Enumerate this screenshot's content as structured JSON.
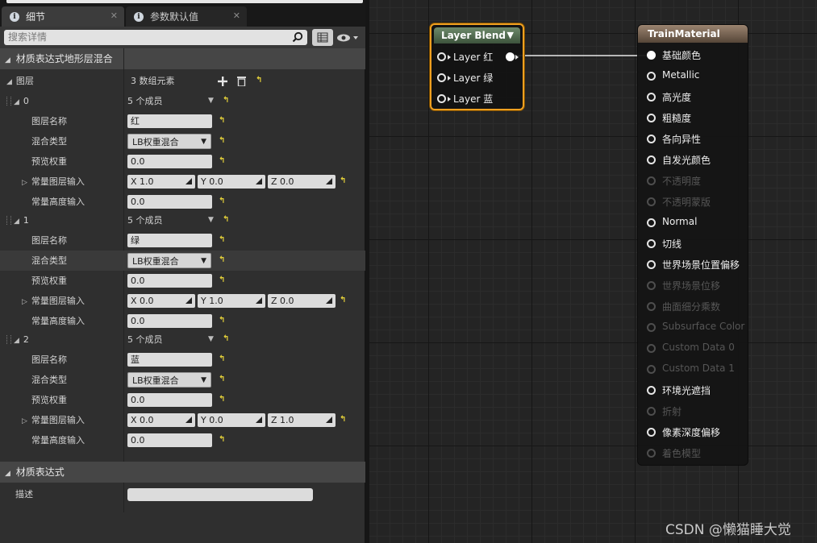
{
  "details_panel": {
    "tabs": [
      {
        "label": "细节",
        "icon": "info-icon"
      },
      {
        "label": "参数默认值",
        "icon": "info-icon"
      }
    ],
    "search_placeholder": "搜索详情",
    "category_main": "材质表达式地形层混合",
    "layers_label": "图层",
    "layers_count": "3 数组元素",
    "layers": [
      {
        "index": "0",
        "members": "5 个成员",
        "layer_name_label": "图层名称",
        "layer_name": "红",
        "blend_type_label": "混合类型",
        "blend_type": "LB权重混合",
        "preview_weight_label": "预览权重",
        "preview_weight": "0.0",
        "const_input_label": "常量图层输入",
        "x": "X  1.0",
        "y": "Y  0.0",
        "z": "Z  0.0",
        "const_height_label": "常量高度输入",
        "const_height": "0.0"
      },
      {
        "index": "1",
        "members": "5 个成员",
        "layer_name_label": "图层名称",
        "layer_name": "绿",
        "blend_type_label": "混合类型",
        "blend_type": "LB权重混合",
        "preview_weight_label": "预览权重",
        "preview_weight": "0.0",
        "const_input_label": "常量图层输入",
        "x": "X  0.0",
        "y": "Y  1.0",
        "z": "Z  0.0",
        "const_height_label": "常量高度输入",
        "const_height": "0.0"
      },
      {
        "index": "2",
        "members": "5 个成员",
        "layer_name_label": "图层名称",
        "layer_name": "蓝",
        "blend_type_label": "混合类型",
        "blend_type": "LB权重混合",
        "preview_weight_label": "预览权重",
        "preview_weight": "0.0",
        "const_input_label": "常量图层输入",
        "x": "X  0.0",
        "y": "Y  0.0",
        "z": "Z  1.0",
        "const_height_label": "常量高度输入",
        "const_height": "0.0"
      }
    ],
    "category_expression": "材质表达式",
    "desc_label": "描述",
    "desc_value": ""
  },
  "graph": {
    "layer_blend_node": {
      "title": "Layer Blend",
      "inputs": [
        "Layer 红",
        "Layer 绿",
        "Layer 蓝"
      ]
    },
    "material_node": {
      "title": "TrainMaterial",
      "pins": [
        {
          "label": "基础颜色",
          "enabled": true,
          "connected": true
        },
        {
          "label": "Metallic",
          "enabled": true
        },
        {
          "label": "高光度",
          "enabled": true
        },
        {
          "label": "粗糙度",
          "enabled": true
        },
        {
          "label": "各向异性",
          "enabled": true
        },
        {
          "label": "自发光颜色",
          "enabled": true
        },
        {
          "label": "不透明度",
          "enabled": false
        },
        {
          "label": "不透明蒙版",
          "enabled": false
        },
        {
          "label": "Normal",
          "enabled": true
        },
        {
          "label": "切线",
          "enabled": true
        },
        {
          "label": "世界场景位置偏移",
          "enabled": true
        },
        {
          "label": "世界场景位移",
          "enabled": false
        },
        {
          "label": "曲面细分乘数",
          "enabled": false
        },
        {
          "label": "Subsurface Color",
          "enabled": false
        },
        {
          "label": "Custom Data 0",
          "enabled": false
        },
        {
          "label": "Custom Data 1",
          "enabled": false
        },
        {
          "label": "环境光遮挡",
          "enabled": true
        },
        {
          "label": "折射",
          "enabled": false
        },
        {
          "label": "像素深度偏移",
          "enabled": true
        },
        {
          "label": "着色模型",
          "enabled": false
        }
      ]
    }
  },
  "watermark": "CSDN @懒猫睡大觉",
  "colors": {
    "selection_outline": "#f0a020",
    "reset_arrow": "#e6d23a"
  }
}
